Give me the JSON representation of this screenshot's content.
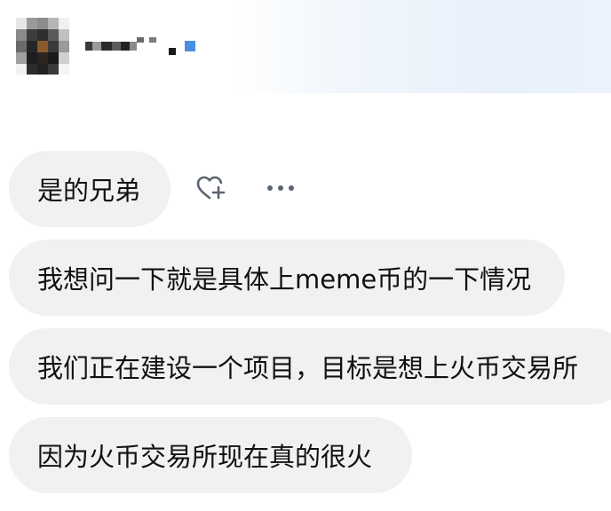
{
  "header": {
    "avatar_icon": "avatar-icon",
    "verified_icon": "verified-badge-icon",
    "verified_color": "#4a90e2"
  },
  "messages": [
    {
      "text": "是的兄弟"
    },
    {
      "text": "我想问一下就是具体上meme币的一下情况"
    },
    {
      "text": "我们正在建设一个项目，目标是想上火币交易所"
    },
    {
      "text": "因为火币交易所现在真的很火"
    }
  ],
  "actions": {
    "react_icon": "heart-plus-icon",
    "more_icon": "more-horizontal-icon"
  },
  "colors": {
    "bubble_bg": "#eff1f3",
    "text": "#111111",
    "icon": "#5a6470"
  }
}
